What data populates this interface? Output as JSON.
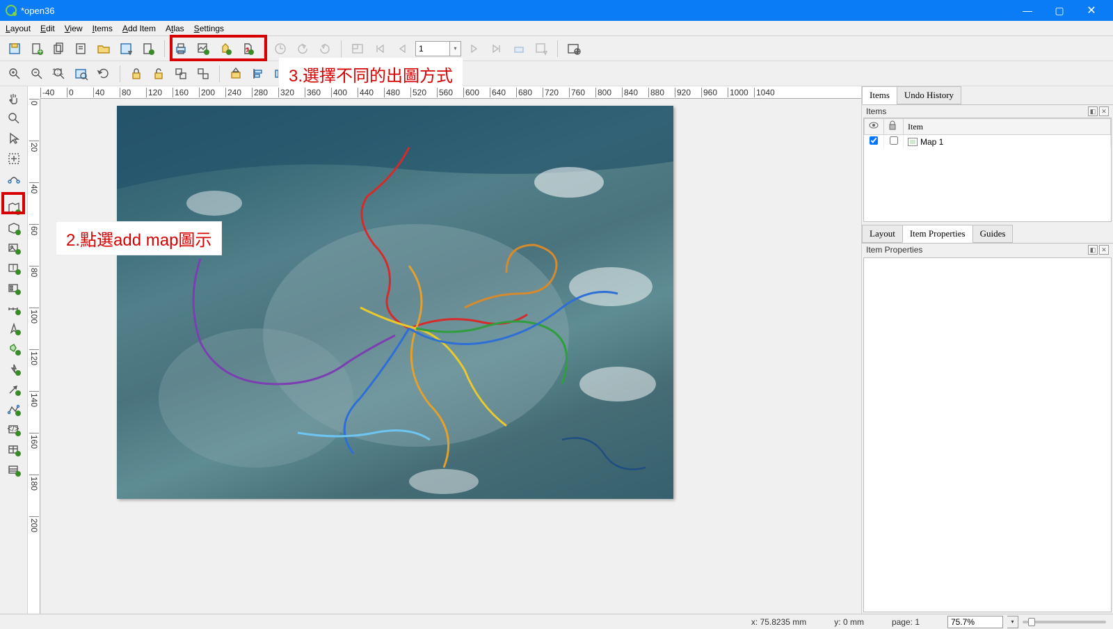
{
  "window": {
    "title": "*open36"
  },
  "menubar": [
    "Layout",
    "Edit",
    "View",
    "Items",
    "Add Item",
    "Atlas",
    "Settings"
  ],
  "toolbar1": {
    "page_input": "1"
  },
  "annotations": {
    "step2": "2.點選add map圖示",
    "step3": "3.選擇不同的出圖方式"
  },
  "right": {
    "tabs_top": [
      "Items",
      "Undo History"
    ],
    "items_header": "Items",
    "items_columns": {
      "item": "Item"
    },
    "items_rows": [
      {
        "visible": true,
        "locked": false,
        "label": "Map 1"
      }
    ],
    "tabs_mid": [
      "Layout",
      "Item Properties",
      "Guides"
    ],
    "props_header": "Item Properties"
  },
  "status": {
    "x_label": "x: 75.8235 mm",
    "y_label": "y: 0 mm",
    "page_label": "page: 1",
    "zoom": "75.7%"
  },
  "ruler_h": [
    -40,
    0,
    40,
    80,
    120,
    160,
    200,
    240,
    280,
    320,
    360,
    400,
    440,
    480,
    520,
    560,
    600,
    640,
    680,
    720,
    760,
    800,
    840,
    880,
    920,
    960,
    1000,
    1040
  ],
  "ruler_v": [
    0,
    20,
    40,
    60,
    80,
    100,
    120,
    140,
    160,
    180,
    200
  ]
}
